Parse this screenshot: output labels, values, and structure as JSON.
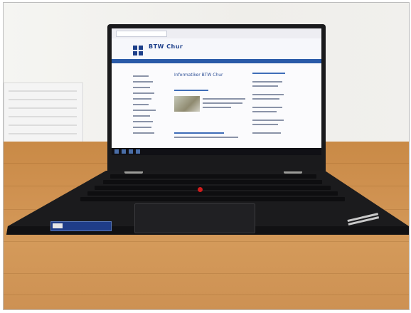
{
  "photo": {
    "subject": "laptop-on-wooden-table",
    "colors": {
      "laptop_body": "#1a1a1c",
      "table_wood": "#cf9150",
      "wall": "#f1f0ed",
      "site_blue": "#1d3f8a",
      "trackpoint_red": "#d01c1c"
    }
  },
  "screen": {
    "site_name": "BTW Chur",
    "page_heading": "Informatiker BTW Chur"
  }
}
